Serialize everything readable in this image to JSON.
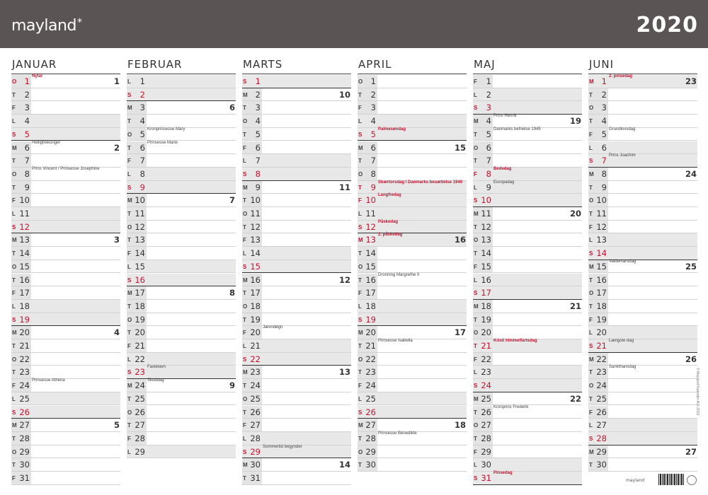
{
  "header": {
    "brand": "mayland",
    "brand_mark": "*",
    "year": "2020"
  },
  "months": [
    {
      "name": "JANUAR",
      "days": [
        {
          "d": "1",
          "wd": "O",
          "red": true,
          "ev": "Nytår",
          "evred": true,
          "wk": "1"
        },
        {
          "d": "2",
          "wd": "T"
        },
        {
          "d": "3",
          "wd": "F"
        },
        {
          "d": "4",
          "wd": "L",
          "we": true
        },
        {
          "d": "5",
          "wd": "S",
          "we": true,
          "red": true,
          "wk_end": true
        },
        {
          "d": "6",
          "wd": "M",
          "ev": "Helligtrekonger",
          "wk": "2"
        },
        {
          "d": "7",
          "wd": "T"
        },
        {
          "d": "8",
          "wd": "O",
          "ev": "Prins Vincent / Prinsesse Josephine"
        },
        {
          "d": "9",
          "wd": "T"
        },
        {
          "d": "10",
          "wd": "F"
        },
        {
          "d": "11",
          "wd": "L",
          "we": true
        },
        {
          "d": "12",
          "wd": "S",
          "we": true,
          "red": true,
          "wk_end": true
        },
        {
          "d": "13",
          "wd": "M",
          "wk": "3"
        },
        {
          "d": "14",
          "wd": "T"
        },
        {
          "d": "15",
          "wd": "O"
        },
        {
          "d": "16",
          "wd": "T"
        },
        {
          "d": "17",
          "wd": "F"
        },
        {
          "d": "18",
          "wd": "L",
          "we": true
        },
        {
          "d": "19",
          "wd": "S",
          "we": true,
          "red": true,
          "wk_end": true
        },
        {
          "d": "20",
          "wd": "M",
          "wk": "4"
        },
        {
          "d": "21",
          "wd": "T"
        },
        {
          "d": "22",
          "wd": "O"
        },
        {
          "d": "23",
          "wd": "T"
        },
        {
          "d": "24",
          "wd": "F",
          "ev": "Prinsesse Athena"
        },
        {
          "d": "25",
          "wd": "L",
          "we": true
        },
        {
          "d": "26",
          "wd": "S",
          "we": true,
          "red": true,
          "wk_end": true
        },
        {
          "d": "27",
          "wd": "M",
          "wk": "5"
        },
        {
          "d": "28",
          "wd": "T"
        },
        {
          "d": "29",
          "wd": "O"
        },
        {
          "d": "30",
          "wd": "T"
        },
        {
          "d": "31",
          "wd": "F"
        }
      ]
    },
    {
      "name": "FEBRUAR",
      "days": [
        {
          "d": "1",
          "wd": "L",
          "we": true
        },
        {
          "d": "2",
          "wd": "S",
          "we": true,
          "red": true,
          "wk_end": true
        },
        {
          "d": "3",
          "wd": "M",
          "wk": "6"
        },
        {
          "d": "4",
          "wd": "T"
        },
        {
          "d": "5",
          "wd": "O",
          "ev": "Kronprinsesse Mary"
        },
        {
          "d": "6",
          "wd": "T",
          "ev": "Prinsesse Marie"
        },
        {
          "d": "7",
          "wd": "F"
        },
        {
          "d": "8",
          "wd": "L",
          "we": true
        },
        {
          "d": "9",
          "wd": "S",
          "we": true,
          "red": true,
          "wk_end": true
        },
        {
          "d": "10",
          "wd": "M",
          "wk": "7"
        },
        {
          "d": "11",
          "wd": "T"
        },
        {
          "d": "12",
          "wd": "O"
        },
        {
          "d": "13",
          "wd": "T"
        },
        {
          "d": "14",
          "wd": "F"
        },
        {
          "d": "15",
          "wd": "L",
          "we": true
        },
        {
          "d": "16",
          "wd": "S",
          "we": true,
          "red": true,
          "wk_end": true
        },
        {
          "d": "17",
          "wd": "M",
          "wk": "8"
        },
        {
          "d": "18",
          "wd": "T"
        },
        {
          "d": "19",
          "wd": "O"
        },
        {
          "d": "20",
          "wd": "T"
        },
        {
          "d": "21",
          "wd": "F"
        },
        {
          "d": "22",
          "wd": "L",
          "we": true
        },
        {
          "d": "23",
          "wd": "S",
          "we": true,
          "red": true,
          "ev": "Fastelavn",
          "wk_end": true
        },
        {
          "d": "24",
          "wd": "M",
          "ev": "Skuddag",
          "wk": "9"
        },
        {
          "d": "25",
          "wd": "T"
        },
        {
          "d": "26",
          "wd": "O"
        },
        {
          "d": "27",
          "wd": "T"
        },
        {
          "d": "28",
          "wd": "F"
        },
        {
          "d": "29",
          "wd": "L",
          "we": true
        }
      ]
    },
    {
      "name": "MARTS",
      "days": [
        {
          "d": "1",
          "wd": "S",
          "we": true,
          "red": true,
          "wk_end": true
        },
        {
          "d": "2",
          "wd": "M",
          "wk": "10"
        },
        {
          "d": "3",
          "wd": "T"
        },
        {
          "d": "4",
          "wd": "O"
        },
        {
          "d": "5",
          "wd": "T"
        },
        {
          "d": "6",
          "wd": "F"
        },
        {
          "d": "7",
          "wd": "L",
          "we": true
        },
        {
          "d": "8",
          "wd": "S",
          "we": true,
          "red": true,
          "wk_end": true
        },
        {
          "d": "9",
          "wd": "M",
          "wk": "11"
        },
        {
          "d": "10",
          "wd": "T"
        },
        {
          "d": "11",
          "wd": "O"
        },
        {
          "d": "12",
          "wd": "T"
        },
        {
          "d": "13",
          "wd": "F"
        },
        {
          "d": "14",
          "wd": "L",
          "we": true
        },
        {
          "d": "15",
          "wd": "S",
          "we": true,
          "red": true,
          "wk_end": true
        },
        {
          "d": "16",
          "wd": "M",
          "wk": "12"
        },
        {
          "d": "17",
          "wd": "T"
        },
        {
          "d": "18",
          "wd": "O"
        },
        {
          "d": "19",
          "wd": "T"
        },
        {
          "d": "20",
          "wd": "F",
          "ev": "Jævndøgn"
        },
        {
          "d": "21",
          "wd": "L",
          "we": true
        },
        {
          "d": "22",
          "wd": "S",
          "we": true,
          "red": true,
          "wk_end": true
        },
        {
          "d": "23",
          "wd": "M",
          "wk": "13"
        },
        {
          "d": "24",
          "wd": "T"
        },
        {
          "d": "25",
          "wd": "O"
        },
        {
          "d": "26",
          "wd": "T"
        },
        {
          "d": "27",
          "wd": "F"
        },
        {
          "d": "28",
          "wd": "L",
          "we": true
        },
        {
          "d": "29",
          "wd": "S",
          "we": true,
          "red": true,
          "ev": "Sommertid begynder",
          "wk_end": true
        },
        {
          "d": "30",
          "wd": "M",
          "wk": "14"
        },
        {
          "d": "31",
          "wd": "T"
        }
      ]
    },
    {
      "name": "APRIL",
      "days": [
        {
          "d": "1",
          "wd": "O"
        },
        {
          "d": "2",
          "wd": "T"
        },
        {
          "d": "3",
          "wd": "F"
        },
        {
          "d": "4",
          "wd": "L",
          "we": true
        },
        {
          "d": "5",
          "wd": "S",
          "we": true,
          "red": true,
          "ev": "Palmesøndag",
          "evred": true,
          "wk_end": true
        },
        {
          "d": "6",
          "wd": "M",
          "wk": "15"
        },
        {
          "d": "7",
          "wd": "T"
        },
        {
          "d": "8",
          "wd": "O"
        },
        {
          "d": "9",
          "wd": "T",
          "red": true,
          "we": true,
          "ev": "Skærtorsdag / Danmarks besættelse 1940",
          "evred": true
        },
        {
          "d": "10",
          "wd": "F",
          "red": true,
          "we": true,
          "ev": "Langfredag",
          "evred": true
        },
        {
          "d": "11",
          "wd": "L",
          "we": true
        },
        {
          "d": "12",
          "wd": "S",
          "we": true,
          "red": true,
          "ev": "Påskedag",
          "evred": true,
          "wk_end": true
        },
        {
          "d": "13",
          "wd": "M",
          "red": true,
          "we": true,
          "ev": "2. påskedag",
          "evred": true,
          "wk": "16"
        },
        {
          "d": "14",
          "wd": "T"
        },
        {
          "d": "15",
          "wd": "O"
        },
        {
          "d": "16",
          "wd": "T",
          "ev": "Dronning Margrethe II"
        },
        {
          "d": "17",
          "wd": "F"
        },
        {
          "d": "18",
          "wd": "L",
          "we": true
        },
        {
          "d": "19",
          "wd": "S",
          "we": true,
          "red": true,
          "wk_end": true
        },
        {
          "d": "20",
          "wd": "M",
          "wk": "17"
        },
        {
          "d": "21",
          "wd": "T",
          "ev": "Prinsesse Isabella"
        },
        {
          "d": "22",
          "wd": "O"
        },
        {
          "d": "23",
          "wd": "T"
        },
        {
          "d": "24",
          "wd": "F"
        },
        {
          "d": "25",
          "wd": "L",
          "we": true
        },
        {
          "d": "26",
          "wd": "S",
          "we": true,
          "red": true,
          "wk_end": true
        },
        {
          "d": "27",
          "wd": "M",
          "wk": "18"
        },
        {
          "d": "28",
          "wd": "T",
          "ev": "Prinsesse Benedikte"
        },
        {
          "d": "29",
          "wd": "O"
        },
        {
          "d": "30",
          "wd": "T"
        }
      ]
    },
    {
      "name": "MAJ",
      "days": [
        {
          "d": "1",
          "wd": "F"
        },
        {
          "d": "2",
          "wd": "L",
          "we": true
        },
        {
          "d": "3",
          "wd": "S",
          "we": true,
          "red": true,
          "wk_end": true
        },
        {
          "d": "4",
          "wd": "M",
          "ev": "Prins Henrik",
          "wk": "19"
        },
        {
          "d": "5",
          "wd": "T",
          "ev": "Danmarks befrielse 1945"
        },
        {
          "d": "6",
          "wd": "O"
        },
        {
          "d": "7",
          "wd": "T"
        },
        {
          "d": "8",
          "wd": "F",
          "red": true,
          "we": true,
          "ev": "Bededag",
          "evred": true
        },
        {
          "d": "9",
          "wd": "L",
          "we": true,
          "ev": "Europadag"
        },
        {
          "d": "10",
          "wd": "S",
          "we": true,
          "red": true,
          "wk_end": true
        },
        {
          "d": "11",
          "wd": "M",
          "wk": "20"
        },
        {
          "d": "12",
          "wd": "T"
        },
        {
          "d": "13",
          "wd": "O"
        },
        {
          "d": "14",
          "wd": "T"
        },
        {
          "d": "15",
          "wd": "F"
        },
        {
          "d": "16",
          "wd": "L",
          "we": true
        },
        {
          "d": "17",
          "wd": "S",
          "we": true,
          "red": true,
          "wk_end": true
        },
        {
          "d": "18",
          "wd": "M",
          "wk": "21"
        },
        {
          "d": "19",
          "wd": "T"
        },
        {
          "d": "20",
          "wd": "O"
        },
        {
          "d": "21",
          "wd": "T",
          "red": true,
          "we": true,
          "ev": "Kristi himmelfartsdag",
          "evred": true
        },
        {
          "d": "22",
          "wd": "F"
        },
        {
          "d": "23",
          "wd": "L",
          "we": true
        },
        {
          "d": "24",
          "wd": "S",
          "we": true,
          "red": true,
          "wk_end": true
        },
        {
          "d": "25",
          "wd": "M",
          "wk": "22"
        },
        {
          "d": "26",
          "wd": "T",
          "ev": "Kronprins Frederik"
        },
        {
          "d": "27",
          "wd": "O"
        },
        {
          "d": "28",
          "wd": "T"
        },
        {
          "d": "29",
          "wd": "F"
        },
        {
          "d": "30",
          "wd": "L",
          "we": true
        },
        {
          "d": "31",
          "wd": "S",
          "we": true,
          "red": true,
          "ev": "Pinsedag",
          "evred": true,
          "wk_end": true
        }
      ]
    },
    {
      "name": "JUNI",
      "days": [
        {
          "d": "1",
          "wd": "M",
          "red": true,
          "we": true,
          "ev": "2. pinsedag",
          "evred": true,
          "wk": "23"
        },
        {
          "d": "2",
          "wd": "T"
        },
        {
          "d": "3",
          "wd": "O"
        },
        {
          "d": "4",
          "wd": "T"
        },
        {
          "d": "5",
          "wd": "F",
          "ev": "Grundlovsdag"
        },
        {
          "d": "6",
          "wd": "L",
          "we": true
        },
        {
          "d": "7",
          "wd": "S",
          "we": true,
          "red": true,
          "ev": "Prins Joachim",
          "wk_end": true
        },
        {
          "d": "8",
          "wd": "M",
          "wk": "24"
        },
        {
          "d": "9",
          "wd": "T"
        },
        {
          "d": "10",
          "wd": "O"
        },
        {
          "d": "11",
          "wd": "T"
        },
        {
          "d": "12",
          "wd": "F"
        },
        {
          "d": "13",
          "wd": "L",
          "we": true
        },
        {
          "d": "14",
          "wd": "S",
          "we": true,
          "red": true,
          "wk_end": true
        },
        {
          "d": "15",
          "wd": "M",
          "ev": "Valdemarsdag",
          "wk": "25"
        },
        {
          "d": "16",
          "wd": "T"
        },
        {
          "d": "17",
          "wd": "O"
        },
        {
          "d": "18",
          "wd": "T"
        },
        {
          "d": "19",
          "wd": "F"
        },
        {
          "d": "20",
          "wd": "L",
          "we": true
        },
        {
          "d": "21",
          "wd": "S",
          "we": true,
          "red": true,
          "ev": "Længste dag",
          "wk_end": true
        },
        {
          "d": "22",
          "wd": "M",
          "wk": "26"
        },
        {
          "d": "23",
          "wd": "T",
          "ev": "Sankthansdag"
        },
        {
          "d": "24",
          "wd": "O"
        },
        {
          "d": "25",
          "wd": "T"
        },
        {
          "d": "26",
          "wd": "F"
        },
        {
          "d": "27",
          "wd": "L",
          "we": true
        },
        {
          "d": "28",
          "wd": "S",
          "we": true,
          "red": true,
          "wk_end": true
        },
        {
          "d": "29",
          "wd": "M",
          "wk": "27"
        },
        {
          "d": "30",
          "wd": "T"
        }
      ]
    }
  ],
  "footer": {
    "brand": "mayland",
    "side_text": "© Mayland Kalender A/S 2019"
  },
  "colors": {
    "header_bg": "#5b5455",
    "holiday_red": "#c4122f",
    "weekend_bg": "#e8e8e8"
  }
}
